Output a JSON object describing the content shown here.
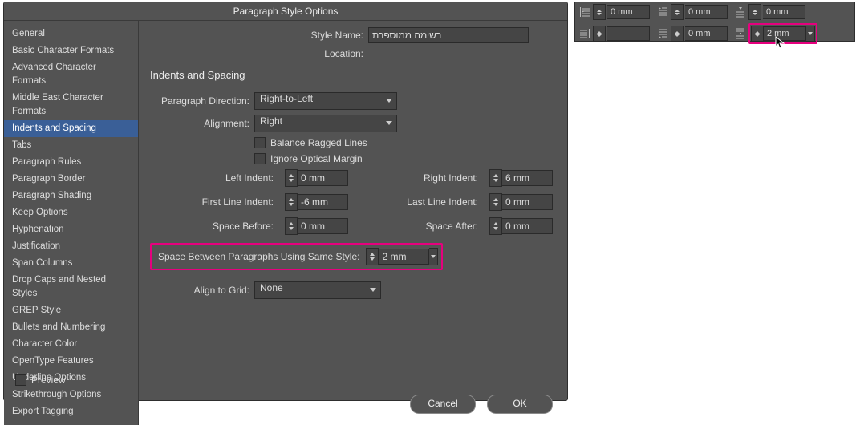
{
  "dialog": {
    "title": "Paragraph Style Options",
    "style_name_label": "Style Name:",
    "style_name_value": "רשימה ממוספרת",
    "location_label": "Location:",
    "section_title": "Indents and Spacing",
    "paragraph_direction_label": "Paragraph Direction:",
    "paragraph_direction_value": "Right-to-Left",
    "alignment_label": "Alignment:",
    "alignment_value": "Right",
    "balance_label": "Balance Ragged Lines",
    "ignore_label": "Ignore Optical Margin",
    "left_indent_label": "Left Indent:",
    "left_indent_value": "0 mm",
    "right_indent_label": "Right Indent:",
    "right_indent_value": "6 mm",
    "first_line_label": "First Line Indent:",
    "first_line_value": "-6 mm",
    "last_line_label": "Last Line Indent:",
    "last_line_value": "0 mm",
    "space_before_label": "Space Before:",
    "space_before_value": "0 mm",
    "space_after_label": "Space After:",
    "space_after_value": "0 mm",
    "space_between_label": "Space Between Paragraphs Using Same Style:",
    "space_between_value": "2 mm",
    "align_grid_label": "Align to Grid:",
    "align_grid_value": "None",
    "cancel": "Cancel",
    "ok": "OK",
    "preview": "Preview"
  },
  "sidebar": {
    "items": [
      "General",
      "Basic Character Formats",
      "Advanced Character Formats",
      "Middle East Character Formats",
      "Indents and Spacing",
      "Tabs",
      "Paragraph Rules",
      "Paragraph Border",
      "Paragraph Shading",
      "Keep Options",
      "Hyphenation",
      "Justification",
      "Span Columns",
      "Drop Caps and Nested Styles",
      "GREP Style",
      "Bullets and Numbering",
      "Character Color",
      "OpenType Features",
      "Underline Options",
      "Strikethrough Options",
      "Export Tagging"
    ],
    "selected_index": 4
  },
  "panel": {
    "row1": {
      "left_indent": "0 mm",
      "first_line": "0 mm",
      "space_before": "0 mm"
    },
    "row2": {
      "right_indent": "",
      "last_line": "0 mm",
      "space_between": "2 mm"
    }
  },
  "highlight_color": "#e6007e"
}
